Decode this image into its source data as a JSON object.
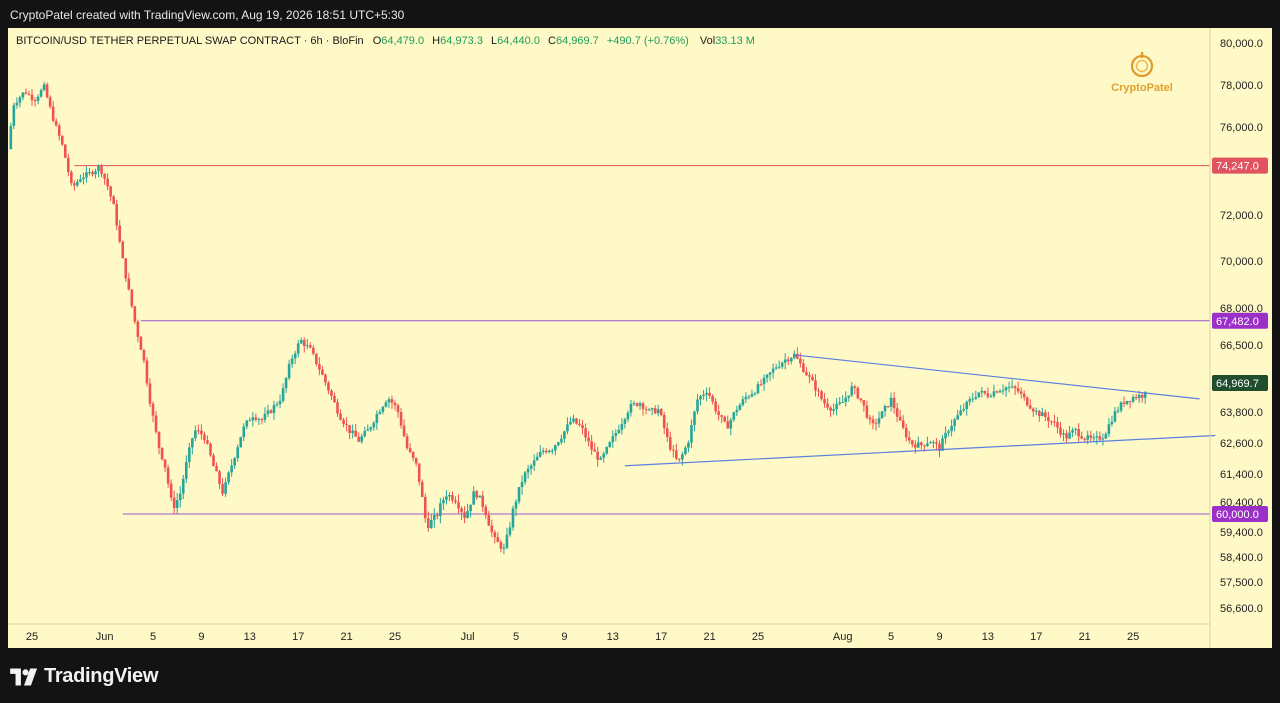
{
  "header": {
    "credit": "CryptoPatel created with TradingView.com, Aug 19, 2026 18:51 UTC+5:30"
  },
  "footer": {
    "brand": "TradingView"
  },
  "watermark": {
    "text": "CryptoPatel"
  },
  "colors": {
    "up": "#26a69a",
    "down": "#ef5350",
    "channel": "#5b7fe0",
    "level": "#c0449a",
    "price_tag": "#1f4d2e",
    "bg": "#fff9c7"
  },
  "chart_data": {
    "type": "candlestick",
    "symbol": "BITCOIN/USD TETHER PERPETUAL SWAP CONTRACT",
    "interval": "6h",
    "exchange": "BloFin",
    "ohlc": {
      "o_label": "O",
      "o": "64,479.0",
      "h_label": "H",
      "h": "64,973.3",
      "l_label": "L",
      "l": "64,440.0",
      "c_label": "C",
      "c": "64,969.7",
      "change": "+490.7 (+0.76%)",
      "vol_label": "Vol",
      "vol": "33.13 M"
    },
    "y_ticks": [
      "80,000.0",
      "78,000.0",
      "76,000.0",
      "72,000.0",
      "70,000.0",
      "68,000.0",
      "66,500.0",
      "63,800.0",
      "62,600.0",
      "61,400.0",
      "60,400.0",
      "59,400.0",
      "58,400.0",
      "57,500.0",
      "56,600.0"
    ],
    "y_tick_values": [
      80000,
      78000,
      76000,
      72000,
      70000,
      68000,
      66500,
      63800,
      62600,
      61400,
      60400,
      59400,
      58400,
      57500,
      56600
    ],
    "x_ticks": [
      {
        "label": "25",
        "day": -1
      },
      {
        "label": "Jun",
        "day": 5
      },
      {
        "label": "5",
        "day": 9
      },
      {
        "label": "9",
        "day": 13
      },
      {
        "label": "13",
        "day": 17
      },
      {
        "label": "17",
        "day": 21
      },
      {
        "label": "21",
        "day": 25
      },
      {
        "label": "25",
        "day": 29
      },
      {
        "label": "Jul",
        "day": 35
      },
      {
        "label": "5",
        "day": 39
      },
      {
        "label": "9",
        "day": 43
      },
      {
        "label": "13",
        "day": 47
      },
      {
        "label": "17",
        "day": 51
      },
      {
        "label": "21",
        "day": 55
      },
      {
        "label": "25",
        "day": 59
      },
      {
        "label": "Aug",
        "day": 66
      },
      {
        "label": "5",
        "day": 70
      },
      {
        "label": "9",
        "day": 74
      },
      {
        "label": "13",
        "day": 78
      },
      {
        "label": "17",
        "day": 82
      },
      {
        "label": "21",
        "day": 86
      },
      {
        "label": "25",
        "day": 90
      }
    ],
    "levels": [
      {
        "label": "74,247.0",
        "value": 74247,
        "from_day": 2.5
      },
      {
        "label": "67,482.0",
        "value": 67482,
        "from_day": 8
      },
      {
        "label": "60,000.0",
        "value": 60000,
        "from_day": 6.5
      }
    ],
    "current_price": {
      "label": "64,969.7",
      "value": 64969.7
    },
    "trendlines": [
      {
        "name": "upper",
        "from": [
          62.0,
          66100
        ],
        "to": [
          95.5,
          64330
        ]
      },
      {
        "name": "lower",
        "from": [
          48.0,
          61720
        ],
        "to": [
          96.8,
          62890
        ]
      }
    ],
    "price_path": [
      [
        -3.0,
        75000
      ],
      [
        -2.5,
        77100
      ],
      [
        -1.6,
        77700
      ],
      [
        -0.8,
        77300
      ],
      [
        0.0,
        77900
      ],
      [
        0.8,
        76300
      ],
      [
        1.6,
        75000
      ],
      [
        2.3,
        73200
      ],
      [
        3.0,
        73700
      ],
      [
        3.8,
        73900
      ],
      [
        4.6,
        74200
      ],
      [
        5.2,
        73400
      ],
      [
        5.8,
        72300
      ],
      [
        6.4,
        70300
      ],
      [
        7.0,
        68700
      ],
      [
        7.6,
        67200
      ],
      [
        8.2,
        66000
      ],
      [
        8.8,
        64100
      ],
      [
        9.4,
        62600
      ],
      [
        10.0,
        61700
      ],
      [
        10.6,
        60200
      ],
      [
        11.2,
        60600
      ],
      [
        11.8,
        61900
      ],
      [
        12.4,
        63100
      ],
      [
        13.2,
        62900
      ],
      [
        14.0,
        61700
      ],
      [
        14.8,
        60700
      ],
      [
        15.6,
        61900
      ],
      [
        16.4,
        63100
      ],
      [
        17.2,
        63700
      ],
      [
        18.0,
        63500
      ],
      [
        18.8,
        63900
      ],
      [
        19.6,
        64400
      ],
      [
        20.4,
        65900
      ],
      [
        21.2,
        66700
      ],
      [
        22.0,
        66300
      ],
      [
        22.8,
        65500
      ],
      [
        23.6,
        64600
      ],
      [
        24.4,
        63700
      ],
      [
        25.2,
        63100
      ],
      [
        26.0,
        62700
      ],
      [
        26.8,
        63100
      ],
      [
        27.6,
        63800
      ],
      [
        28.4,
        64400
      ],
      [
        29.2,
        63900
      ],
      [
        30.0,
        62400
      ],
      [
        30.8,
        61700
      ],
      [
        31.6,
        59600
      ],
      [
        32.4,
        59900
      ],
      [
        33.2,
        60700
      ],
      [
        34.0,
        60500
      ],
      [
        34.8,
        59900
      ],
      [
        35.6,
        60800
      ],
      [
        36.4,
        60200
      ],
      [
        37.2,
        59100
      ],
      [
        38.0,
        58700
      ],
      [
        38.8,
        60200
      ],
      [
        39.6,
        61300
      ],
      [
        40.4,
        61800
      ],
      [
        41.2,
        62300
      ],
      [
        42.0,
        62400
      ],
      [
        42.8,
        62900
      ],
      [
        43.6,
        63500
      ],
      [
        44.4,
        63200
      ],
      [
        45.2,
        62400
      ],
      [
        46.0,
        61900
      ],
      [
        46.8,
        62600
      ],
      [
        47.6,
        63300
      ],
      [
        48.4,
        64000
      ],
      [
        49.2,
        64200
      ],
      [
        50.0,
        63800
      ],
      [
        50.8,
        63900
      ],
      [
        51.6,
        62600
      ],
      [
        52.4,
        61800
      ],
      [
        53.2,
        62600
      ],
      [
        54.0,
        64300
      ],
      [
        54.8,
        64700
      ],
      [
        55.6,
        63800
      ],
      [
        56.4,
        63200
      ],
      [
        57.2,
        63900
      ],
      [
        58.0,
        64400
      ],
      [
        58.8,
        64700
      ],
      [
        59.6,
        65100
      ],
      [
        60.4,
        65600
      ],
      [
        61.2,
        65900
      ],
      [
        62.0,
        66100
      ],
      [
        62.8,
        65500
      ],
      [
        63.6,
        64900
      ],
      [
        64.4,
        64200
      ],
      [
        65.2,
        63900
      ],
      [
        66.0,
        64200
      ],
      [
        66.8,
        64800
      ],
      [
        67.6,
        64200
      ],
      [
        68.4,
        63200
      ],
      [
        69.2,
        63700
      ],
      [
        70.0,
        64300
      ],
      [
        70.8,
        63300
      ],
      [
        71.6,
        62600
      ],
      [
        72.4,
        62500
      ],
      [
        73.2,
        62700
      ],
      [
        74.0,
        62400
      ],
      [
        74.8,
        63200
      ],
      [
        75.6,
        63700
      ],
      [
        76.4,
        64200
      ],
      [
        77.2,
        64600
      ],
      [
        78.0,
        64500
      ],
      [
        78.8,
        64700
      ],
      [
        79.6,
        64800
      ],
      [
        80.4,
        64700
      ],
      [
        81.2,
        64200
      ],
      [
        82.0,
        63800
      ],
      [
        82.8,
        63600
      ],
      [
        83.6,
        63300
      ],
      [
        84.4,
        62800
      ],
      [
        85.2,
        63100
      ],
      [
        86.0,
        62800
      ],
      [
        86.8,
        62700
      ],
      [
        87.6,
        62900
      ],
      [
        88.4,
        63700
      ],
      [
        89.2,
        64200
      ],
      [
        90.0,
        64400
      ],
      [
        90.8,
        64479
      ],
      [
        91.2,
        64969.7
      ]
    ]
  }
}
